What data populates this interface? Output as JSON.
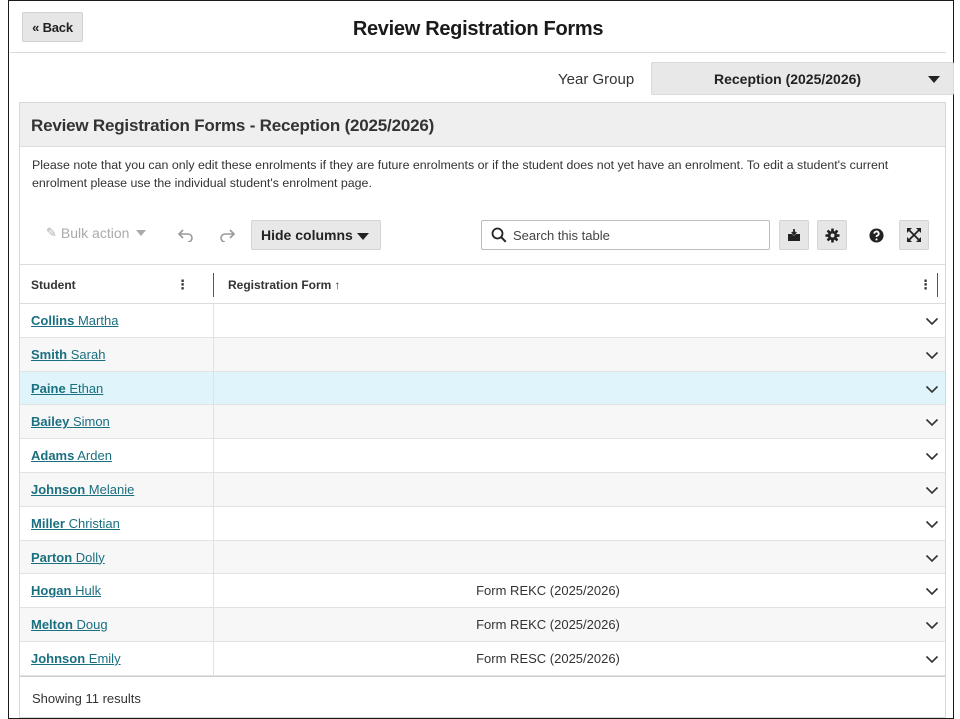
{
  "header": {
    "back_label": "« Back",
    "title": "Review Registration Forms"
  },
  "year_group": {
    "label": "Year Group",
    "selected": "Reception (2025/2026)"
  },
  "panel": {
    "title": "Review Registration Forms - Reception (2025/2026)",
    "notice": "Please note that you can only edit these enrolments if they are future enrolments or if the student does not yet have an enrolment. To edit a student's current enrolment please use the individual student's enrolment page."
  },
  "toolbar": {
    "bulk_action_label": "Bulk action",
    "hide_columns_label": "Hide columns",
    "search_placeholder": "Search this table",
    "icons": [
      "pencil-icon",
      "undo-icon",
      "redo-icon",
      "search-icon",
      "export-icon",
      "gear-icon",
      "help-icon",
      "expand-icon"
    ]
  },
  "table": {
    "columns": [
      {
        "label": "Student",
        "menu": "⋮"
      },
      {
        "label": "Registration Form",
        "sort": "↑",
        "menu": "⋮"
      }
    ],
    "rows": [
      {
        "last": "Collins",
        "first": "Martha",
        "form": ""
      },
      {
        "last": "Smith",
        "first": "Sarah",
        "form": ""
      },
      {
        "last": "Paine",
        "first": "Ethan",
        "form": ""
      },
      {
        "last": "Bailey",
        "first": "Simon",
        "form": ""
      },
      {
        "last": "Adams",
        "first": "Arden",
        "form": ""
      },
      {
        "last": "Johnson",
        "first": "Melanie",
        "form": ""
      },
      {
        "last": "Miller",
        "first": "Christian",
        "form": ""
      },
      {
        "last": "Parton",
        "first": "Dolly",
        "form": ""
      },
      {
        "last": "Hogan",
        "first": "Hulk",
        "form": "Form REKC (2025/2026)"
      },
      {
        "last": "Melton",
        "first": "Doug",
        "form": "Form REKC (2025/2026)"
      },
      {
        "last": "Johnson",
        "first": "Emily",
        "form": "Form RESC (2025/2026)"
      }
    ],
    "highlighted_row_index": 2
  },
  "footer": {
    "results_text": "Showing 11 results"
  },
  "colors": {
    "link": "#1a6f80",
    "row_highlight": "#dff5fb",
    "button_bg": "#e8e8e8",
    "panel_header_bg": "#efefef"
  }
}
